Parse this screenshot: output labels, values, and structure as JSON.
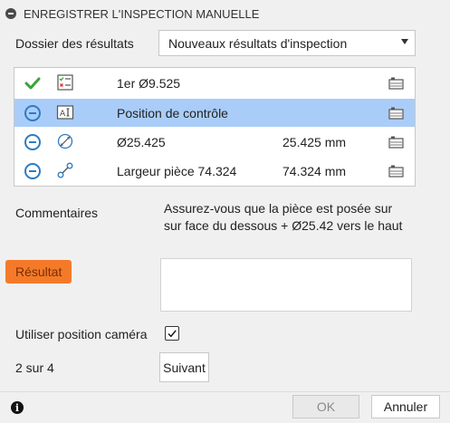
{
  "dialog": {
    "title": "ENREGISTRER L'INSPECTION MANUELLE"
  },
  "results_folder": {
    "label": "Dossier des résultats",
    "selected": "Nouveaux résultats d'inspection"
  },
  "inspections": [
    {
      "state": "check-icon",
      "type": "checklist-icon",
      "name": "1er Ø9.525",
      "value": "",
      "selected": false
    },
    {
      "state": "minus-circle-icon",
      "type": "text-annotation-icon",
      "name": "Position de contrôle",
      "value": "",
      "selected": true
    },
    {
      "state": "minus-circle-icon",
      "type": "diameter-icon",
      "name": "Ø25.425",
      "value": "25.425 mm",
      "selected": false
    },
    {
      "state": "minus-circle-icon",
      "type": "distance-icon",
      "name": "Largeur pièce 74.324",
      "value": "74.324 mm",
      "selected": false
    }
  ],
  "comments": {
    "label": "Commentaires",
    "line1": "Assurez-vous que la pièce est posée sur",
    "line2": "sur face du dessous + Ø25.42 vers le haut"
  },
  "result": {
    "label": "Résultat",
    "value": ""
  },
  "camera": {
    "label": "Utiliser position caméra",
    "checked": true
  },
  "progress": {
    "label": "2 sur 4",
    "next_button": "Suivant"
  },
  "footer": {
    "ok_button": "OK",
    "cancel_button": "Annuler"
  },
  "colors": {
    "selection": "#a9cdf8",
    "highlight": "#f47a2a",
    "check": "#3aa33a",
    "accent": "#2f7bc2"
  }
}
